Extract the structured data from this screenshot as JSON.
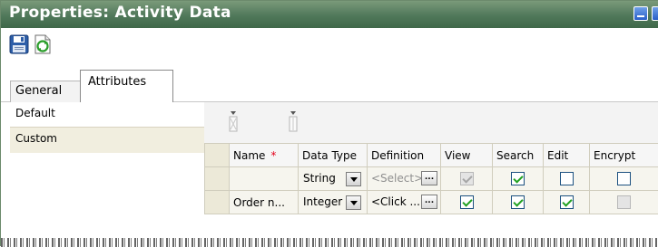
{
  "window": {
    "title": "Properties: Activity Data"
  },
  "toolbar": {
    "save_icon": "save-icon",
    "refresh_icon": "refresh-icon"
  },
  "tabs": [
    {
      "label": "General"
    },
    {
      "label": "Attributes"
    }
  ],
  "left_list": [
    {
      "label": "Default"
    },
    {
      "label": "Custom"
    }
  ],
  "grid": {
    "headers": {
      "name": "Name",
      "required_mark": "*",
      "data_type": "Data Type",
      "definition": "Definition",
      "view": "View",
      "search": "Search",
      "edit": "Edit",
      "encrypt": "Encrypt"
    },
    "rows": [
      {
        "name": "",
        "data_type": "String",
        "definition": "<Select>",
        "ellipsis": "...",
        "view": true,
        "search": true,
        "edit": false,
        "encrypt": false
      },
      {
        "name": "Order n...",
        "data_type": "Integer",
        "definition": "<Click ...",
        "ellipsis": "...",
        "view": true,
        "search": true,
        "edit": true,
        "encrypt": false
      }
    ]
  },
  "colors": {
    "title_bar": "#50785a",
    "tab_border": "#8a8a8a",
    "row_header": "#ece9d8",
    "required": "#e4001b",
    "check": "#21a121"
  }
}
